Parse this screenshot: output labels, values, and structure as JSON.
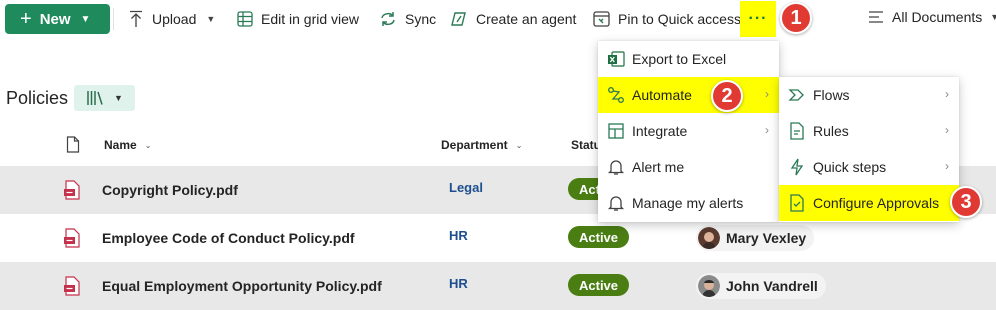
{
  "command_bar": {
    "new_label": "New",
    "upload_label": "Upload",
    "grid_label": "Edit in grid view",
    "sync_label": "Sync",
    "agent_label": "Create an agent",
    "pin_label": "Pin to Quick access",
    "more_label": "···",
    "view_label": "All Documents"
  },
  "list": {
    "title": "Policies"
  },
  "columns": {
    "name": "Name",
    "department": "Department",
    "status": "Statu"
  },
  "rows": [
    {
      "name": "Copyright Policy.pdf",
      "department": "Legal",
      "status": "Acti"
    },
    {
      "name": "Employee Code of Conduct Policy.pdf",
      "department": "HR",
      "status": "Active",
      "person": "Mary Vexley"
    },
    {
      "name": "Equal Employment Opportunity Policy.pdf",
      "department": "HR",
      "status": "Active",
      "person": "John Vandrell"
    }
  ],
  "overflow_menu": {
    "items": [
      "Export to Excel",
      "Automate",
      "Integrate",
      "Alert me",
      "Manage my alerts"
    ]
  },
  "automate_submenu": {
    "items": [
      "Flows",
      "Rules",
      "Quick steps",
      "Configure Approvals"
    ]
  },
  "markers": [
    "1",
    "2",
    "3"
  ],
  "colors": {
    "accent": "#1f8a5c",
    "highlight": "#ffff00",
    "marker": "#e03a32",
    "status": "#4a7e13",
    "department_link": "#1e4f8f"
  }
}
